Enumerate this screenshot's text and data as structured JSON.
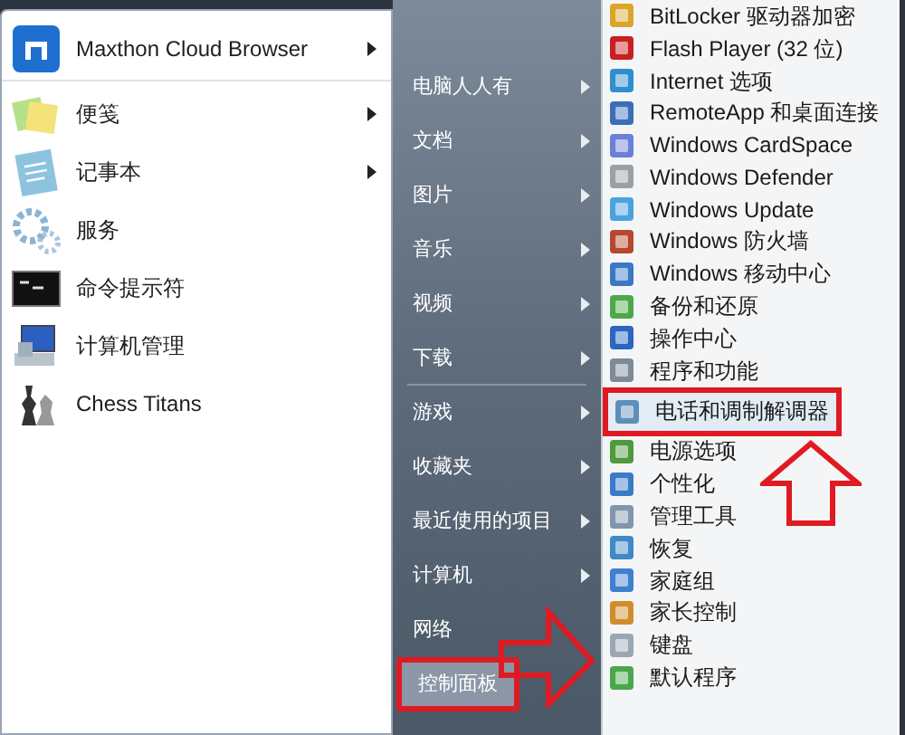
{
  "programs": [
    {
      "label": "Maxthon Cloud Browser",
      "kind": "browser",
      "has_submenu": true
    },
    {
      "label": "便笺",
      "kind": "notes",
      "has_submenu": true
    },
    {
      "label": "记事本",
      "kind": "notepad",
      "has_submenu": true
    },
    {
      "label": "服务",
      "kind": "gears",
      "has_submenu": false
    },
    {
      "label": "命令提示符",
      "kind": "terminal",
      "has_submenu": false
    },
    {
      "label": "计算机管理",
      "kind": "computer",
      "has_submenu": false
    },
    {
      "label": "Chess Titans",
      "kind": "chess",
      "has_submenu": false
    }
  ],
  "places": [
    {
      "label": "电脑人人有",
      "has_submenu": true,
      "selected": false,
      "highlighted": false
    },
    {
      "label": "文档",
      "has_submenu": true,
      "selected": false,
      "highlighted": false
    },
    {
      "label": "图片",
      "has_submenu": true,
      "selected": false,
      "highlighted": false
    },
    {
      "label": "音乐",
      "has_submenu": true,
      "selected": false,
      "highlighted": false
    },
    {
      "label": "视频",
      "has_submenu": true,
      "selected": false,
      "highlighted": false
    },
    {
      "label": "下载",
      "has_submenu": true,
      "selected": false,
      "highlighted": false
    },
    {
      "label": "游戏",
      "has_submenu": true,
      "selected": false,
      "highlighted": false
    },
    {
      "label": "收藏夹",
      "has_submenu": true,
      "selected": false,
      "highlighted": false
    },
    {
      "label": "最近使用的项目",
      "has_submenu": true,
      "selected": false,
      "highlighted": false
    },
    {
      "label": "计算机",
      "has_submenu": true,
      "selected": false,
      "highlighted": false
    },
    {
      "label": "网络",
      "has_submenu": false,
      "selected": false,
      "highlighted": false
    },
    {
      "label": "控制面板",
      "has_submenu": false,
      "selected": true,
      "highlighted": true
    }
  ],
  "control_panel_items": [
    {
      "label": "BitLocker 驱动器加密",
      "selected": false,
      "highlighted": false
    },
    {
      "label": "Flash Player (32 位)",
      "selected": false,
      "highlighted": false
    },
    {
      "label": "Internet 选项",
      "selected": false,
      "highlighted": false
    },
    {
      "label": "RemoteApp 和桌面连接",
      "selected": false,
      "highlighted": false
    },
    {
      "label": "Windows CardSpace",
      "selected": false,
      "highlighted": false
    },
    {
      "label": "Windows Defender",
      "selected": false,
      "highlighted": false
    },
    {
      "label": "Windows Update",
      "selected": false,
      "highlighted": false
    },
    {
      "label": "Windows 防火墙",
      "selected": false,
      "highlighted": false
    },
    {
      "label": "Windows 移动中心",
      "selected": false,
      "highlighted": false
    },
    {
      "label": "备份和还原",
      "selected": false,
      "highlighted": false
    },
    {
      "label": "操作中心",
      "selected": false,
      "highlighted": false
    },
    {
      "label": "程序和功能",
      "selected": false,
      "highlighted": false
    },
    {
      "label": "电话和调制解调器",
      "selected": true,
      "highlighted": true
    },
    {
      "label": "电源选项",
      "selected": false,
      "highlighted": false
    },
    {
      "label": "个性化",
      "selected": false,
      "highlighted": false
    },
    {
      "label": "管理工具",
      "selected": false,
      "highlighted": false
    },
    {
      "label": "恢复",
      "selected": false,
      "highlighted": false
    },
    {
      "label": "家庭组",
      "selected": false,
      "highlighted": false
    },
    {
      "label": "家长控制",
      "selected": false,
      "highlighted": false
    },
    {
      "label": "键盘",
      "selected": false,
      "highlighted": false
    },
    {
      "label": "默认程序",
      "selected": false,
      "highlighted": false
    }
  ]
}
